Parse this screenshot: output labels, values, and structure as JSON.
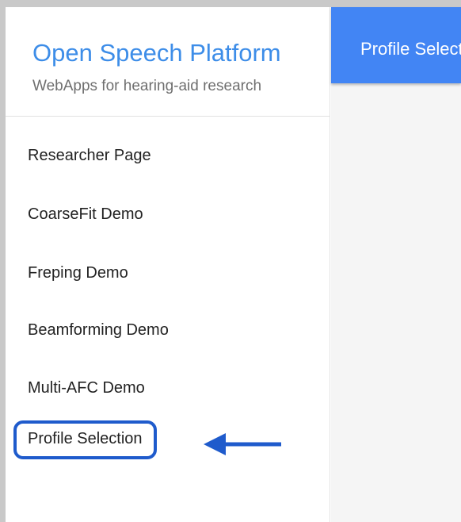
{
  "brand": {
    "title": "Open Speech Platform",
    "subtitle": "WebApps for hearing-aid research"
  },
  "sidebar": {
    "items": [
      {
        "label": "Researcher Page"
      },
      {
        "label": "CoarseFit Demo"
      },
      {
        "label": "Freping Demo"
      },
      {
        "label": "Beamforming Demo"
      },
      {
        "label": "Multi-AFC Demo"
      },
      {
        "label": "Profile Selection",
        "highlighted": true
      }
    ]
  },
  "header": {
    "title": "Profile Selection"
  },
  "colors": {
    "brand": "#3d8de8",
    "appbar": "#4285f4",
    "highlight_border": "#1f5bcc",
    "annotation_arrow": "#1f5bcc"
  },
  "icons": {
    "annotation": "left-arrow-icon"
  }
}
